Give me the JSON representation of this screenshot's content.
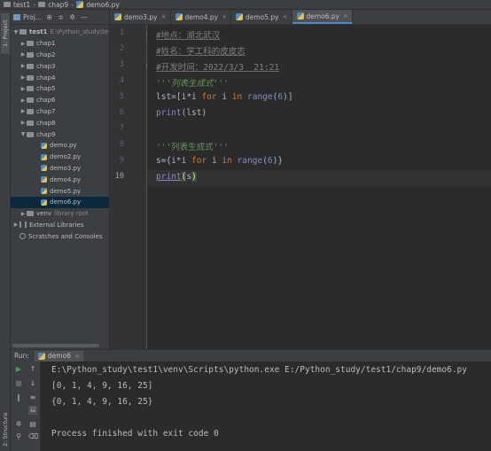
{
  "breadcrumb": [
    "test1",
    "chap9",
    "demo6.py"
  ],
  "sidebar_tabs": {
    "project": "1: Project",
    "structure": "2: Structure"
  },
  "project_panel": {
    "dropdown_label": "Proj...",
    "root": {
      "name": "test1",
      "path": "E:\\Python_study\\te"
    },
    "folders": [
      "chap1",
      "chap2",
      "chap3",
      "chap4",
      "chap5",
      "chap6",
      "chap7",
      "chap8",
      "chap9"
    ],
    "chap9_files": [
      "demo.py",
      "demo2.py",
      "demo3.py",
      "demo4.py",
      "demo5.py",
      "demo6.py"
    ],
    "venv": {
      "name": "venv",
      "note": "library root"
    },
    "external_libraries": "External Libraries",
    "scratches": "Scratches and Consoles"
  },
  "editor_tabs": [
    "demo3.py",
    "demo4.py",
    "demo5.py",
    "demo6.py"
  ],
  "active_tab": "demo6.py",
  "line_numbers": [
    "1",
    "2",
    "3",
    "4",
    "5",
    "6",
    "7",
    "8",
    "9",
    "10"
  ],
  "code": {
    "l1": "#地点：湖北武汉",
    "l2": "#姓名：学工科的皮皮志",
    "l3": "#开发时间：2022/3/3  21:21",
    "l4": "'''列表生成式'''",
    "l5_a": "lst=[i*i ",
    "l5_for": "for",
    "l5_b": " i ",
    "l5_in": "in",
    "l5_sp": " ",
    "l5_range": "range",
    "l5_open": "(",
    "l5_num": "6",
    "l5_close": ")]",
    "l6_print": "print",
    "l6_rest": "(lst)",
    "l8": "'''列表生成式'''",
    "l9_a": "s={i*i ",
    "l9_for": "for",
    "l9_b": " i ",
    "l9_in": "in",
    "l9_sp": " ",
    "l9_range": "range",
    "l9_open": "(",
    "l9_num": "6",
    "l9_close": ")}",
    "l10_print": "print",
    "l10_open": "(",
    "l10_arg": "s",
    "l10_close": ")"
  },
  "run_panel": {
    "label": "Run:",
    "tab": "demo6",
    "output": [
      "E:\\Python_study\\test1\\venv\\Scripts\\python.exe E:/Python_study/test1/chap9/demo6.py",
      "[0, 1, 4, 9, 16, 25]",
      "{0, 1, 4, 9, 16, 25}",
      "",
      "Process finished with exit code 0"
    ]
  },
  "colors": {
    "accent": "#4a88c7",
    "run_green": "#499c54",
    "stop_red": "#c75450"
  }
}
